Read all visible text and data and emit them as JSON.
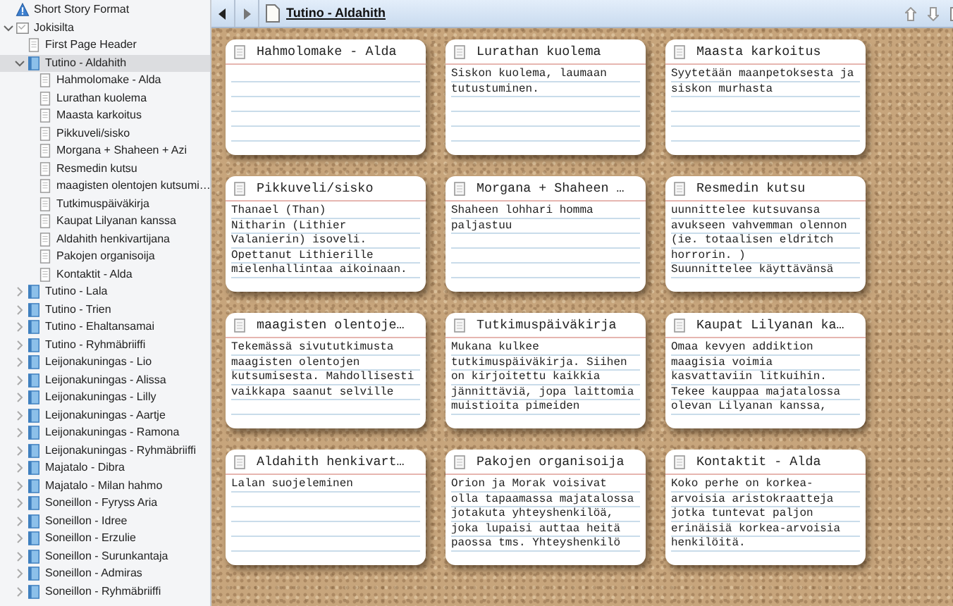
{
  "sidebar": {
    "items": [
      {
        "label": "Short Story Format",
        "kind": "warning",
        "selected": false
      },
      {
        "label": "Jokisilta",
        "kind": "collection",
        "selected": false,
        "expanded": true,
        "children": [
          {
            "label": "First Page Header",
            "kind": "page",
            "selected": false
          },
          {
            "label": "Tutino - Aldahith",
            "kind": "folder",
            "selected": true,
            "expanded": true,
            "children": [
              {
                "label": "Hahmolomake - Alda",
                "kind": "page",
                "selected": false
              },
              {
                "label": "Lurathan kuolema",
                "kind": "page",
                "selected": false
              },
              {
                "label": "Maasta karkoitus",
                "kind": "page",
                "selected": false
              },
              {
                "label": "Pikkuveli/sisko",
                "kind": "page",
                "selected": false
              },
              {
                "label": "Morgana + Shaheen + Azi",
                "kind": "page",
                "selected": false
              },
              {
                "label": "Resmedin kutsu",
                "kind": "page",
                "selected": false
              },
              {
                "label": "maagisten olentojen kutsumi…",
                "kind": "page",
                "selected": false
              },
              {
                "label": "Tutkimuspäiväkirja",
                "kind": "page",
                "selected": false
              },
              {
                "label": "Kaupat Lilyanan kanssa",
                "kind": "page",
                "selected": false
              },
              {
                "label": "Aldahith henkivartijana",
                "kind": "page",
                "selected": false
              },
              {
                "label": "Pakojen organisoija",
                "kind": "page",
                "selected": false
              },
              {
                "label": "Kontaktit - Alda",
                "kind": "page",
                "selected": false
              }
            ]
          },
          {
            "label": "Tutino - Lala",
            "kind": "folder",
            "selected": false,
            "expanded": false
          },
          {
            "label": "Tutino - Trien",
            "kind": "folder",
            "selected": false,
            "expanded": false
          },
          {
            "label": "Tutino - Ehaltansamai",
            "kind": "folder",
            "selected": false,
            "expanded": false
          },
          {
            "label": "Tutino - Ryhmäbriiffi",
            "kind": "folder",
            "selected": false,
            "expanded": false
          },
          {
            "label": "Leijonakuningas - Lio",
            "kind": "folder",
            "selected": false,
            "expanded": false
          },
          {
            "label": "Leijonakuningas - Alissa",
            "kind": "folder",
            "selected": false,
            "expanded": false
          },
          {
            "label": "Leijonakuningas - Lilly",
            "kind": "folder",
            "selected": false,
            "expanded": false
          },
          {
            "label": "Leijonakuningas - Aartje",
            "kind": "folder",
            "selected": false,
            "expanded": false
          },
          {
            "label": "Leijonakuningas - Ramona",
            "kind": "folder",
            "selected": false,
            "expanded": false
          },
          {
            "label": "Leijonakuningas - Ryhmäbriiffi",
            "kind": "folder",
            "selected": false,
            "expanded": false
          },
          {
            "label": "Majatalo - Dibra",
            "kind": "folder",
            "selected": false,
            "expanded": false
          },
          {
            "label": "Majatalo - Milan hahmo",
            "kind": "folder",
            "selected": false,
            "expanded": false
          },
          {
            "label": "Soneillon - Fyryss Aria",
            "kind": "folder",
            "selected": false,
            "expanded": false
          },
          {
            "label": "Soneillon - Idree",
            "kind": "folder",
            "selected": false,
            "expanded": false
          },
          {
            "label": "Soneillon - Erzulie",
            "kind": "folder",
            "selected": false,
            "expanded": false
          },
          {
            "label": "Soneillon - Surunkantaja",
            "kind": "folder",
            "selected": false,
            "expanded": false
          },
          {
            "label": "Soneillon - Admiras",
            "kind": "folder",
            "selected": false,
            "expanded": false
          },
          {
            "label": "Soneillon - Ryhmäbriiffi",
            "kind": "folder",
            "selected": false,
            "expanded": false
          }
        ]
      }
    ]
  },
  "editor": {
    "title": "Tutino - Aldahith"
  },
  "corkboard": {
    "cards": [
      {
        "title": "Hahmolomake - Alda"
      },
      {
        "title": "Lurathan kuolema",
        "lines": [
          "Siskon kuolema, laumaan",
          "tutustuminen."
        ]
      },
      {
        "title": "Maasta karkoitus",
        "lines": [
          "Syytetään maanpetoksesta ja",
          "siskon murhasta"
        ]
      },
      {
        "title": "Pikkuveli/sisko",
        "lines": [
          "Thanael (Than)",
          "Nitharin (Lithier",
          "Valanierin) isoveli.",
          "Opettanut Lithierille",
          "mielenhallintaa aikoinaan."
        ]
      },
      {
        "title": "Morgana + Shaheen …",
        "lines": [
          "Shaheen lohhari homma",
          "paljastuu"
        ]
      },
      {
        "title": "Resmedin kutsu",
        "lines": [
          "uunnittelee kutsuvansa",
          "avukseen vahvemman olennon",
          "(ie. totaalisen eldritch",
          "horrorin. )",
          "Suunnittelee käyttävänsä"
        ]
      },
      {
        "title": "maagisten olentoje…",
        "lines": [
          "Tekemässä sivututkimusta",
          "maagisten olentojen",
          "kutsumisesta. Mahdollisesti",
          "vaikkapa saanut selville"
        ]
      },
      {
        "title": "Tutkimuspäiväkirja",
        "lines": [
          "Mukana kulkee",
          "tutkimuspäiväkirja. Siihen",
          "on kirjoitettu kaikkia",
          "jännittäviä, jopa laittomia",
          "muistioita pimeiden"
        ]
      },
      {
        "title": "Kaupat Lilyanan ka…",
        "lines": [
          "Omaa kevyen addiktion",
          "maagisia voimia",
          "kasvattaviin litkuihin.",
          "Tekee kauppaa majatalossa",
          "olevan Lilyanan kanssa,"
        ]
      },
      {
        "title": "Aldahith henkivart…",
        "lines": [
          "Lalan suojeleminen"
        ]
      },
      {
        "title": "Pakojen organisoija",
        "lines": [
          "Orion ja Morak voisivat",
          "olla tapaamassa majatalossa",
          "jotakuta yhteyshenkilöä,",
          "joka lupaisi auttaa heitä",
          "paossa tms. Yhteyshenkilö"
        ]
      },
      {
        "title": "Kontaktit - Alda",
        "lines": [
          "Koko perhe on korkea-",
          "arvoisia aristokraatteja",
          "jotka tuntevat paljon",
          "erinäisiä korkea-arvoisia",
          "henkilöitä."
        ]
      }
    ]
  }
}
